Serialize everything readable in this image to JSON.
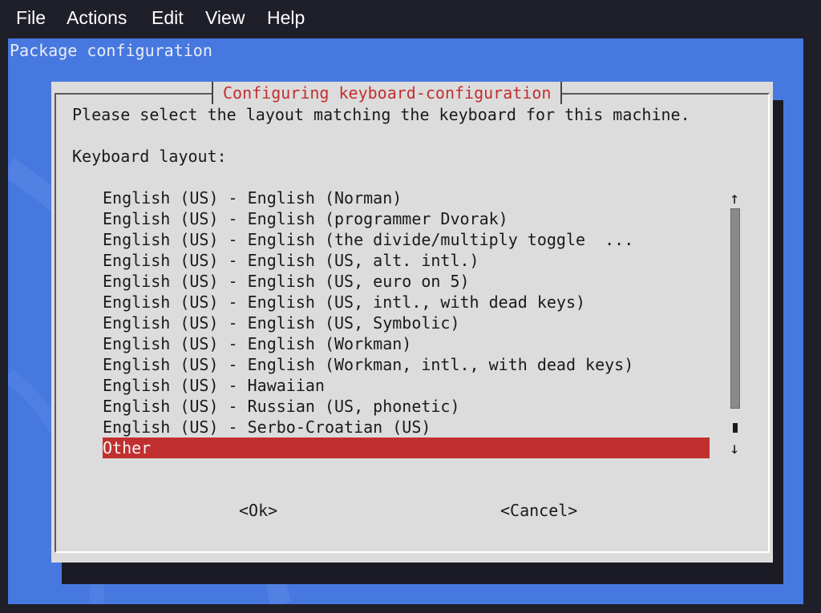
{
  "menubar": {
    "items": [
      "File",
      "Actions",
      "Edit",
      "View",
      "Help"
    ]
  },
  "terminal": {
    "title": "Package configuration"
  },
  "dialog": {
    "title": "Configuring keyboard-configuration",
    "prompt": "Please select the layout matching the keyboard for this machine.",
    "list_label": "Keyboard layout:",
    "options": [
      "English (US) - English (Norman)",
      "English (US) - English (programmer Dvorak)",
      "English (US) - English (the divide/multiply toggle  ...",
      "English (US) - English (US, alt. intl.)",
      "English (US) - English (US, euro on 5)",
      "English (US) - English (US, intl., with dead keys)",
      "English (US) - English (US, Symbolic)",
      "English (US) - English (Workman)",
      "English (US) - English (Workman, intl., with dead keys)",
      "English (US) - Hawaiian",
      "English (US) - Russian (US, phonetic)",
      "English (US) - Serbo-Croatian (US)",
      "Other"
    ],
    "selected_option": "Other",
    "scroll_up_glyph": "↑",
    "scroll_down_glyph": "↓",
    "ok_label": "<Ok>",
    "cancel_label": "<Cancel>"
  },
  "colors": {
    "terminal_bg": "#4778e0",
    "dialog_bg": "#dcdcdc",
    "accent_red": "#c22f2f",
    "menubar_bg": "#1e1f29"
  }
}
